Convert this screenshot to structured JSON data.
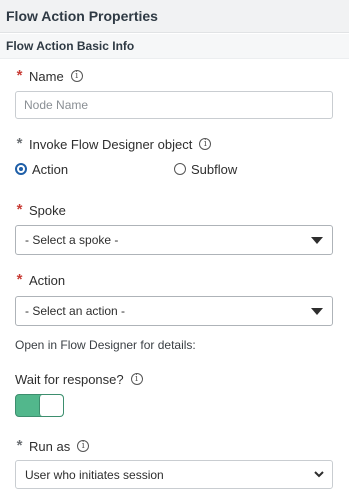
{
  "panel": {
    "title": "Flow Action Properties",
    "section_title": "Flow Action Basic Info"
  },
  "fields": {
    "name": {
      "required_mark": "*",
      "label": "Name",
      "info": "i",
      "placeholder": "Node Name"
    },
    "invoke": {
      "required_mark": "*",
      "label": "Invoke Flow Designer object",
      "info": "i",
      "options": [
        "Action",
        "Subflow"
      ],
      "selected": "Action"
    },
    "spoke": {
      "required_mark": "*",
      "label": "Spoke",
      "value": "- Select a spoke -"
    },
    "action": {
      "required_mark": "*",
      "label": "Action",
      "value": "- Select an action -"
    },
    "details_note": "Open in Flow Designer for details:",
    "wait": {
      "label": "Wait for response?",
      "info": "i",
      "enabled": true
    },
    "run_as": {
      "required_mark": "*",
      "label": "Run as",
      "info": "i",
      "value": "User who initiates session"
    }
  },
  "colors": {
    "required_red": "#c83c36",
    "required_grey": "#6b6f73",
    "radio_blue": "#1f5fa8",
    "toggle_green": "#52b78c"
  }
}
